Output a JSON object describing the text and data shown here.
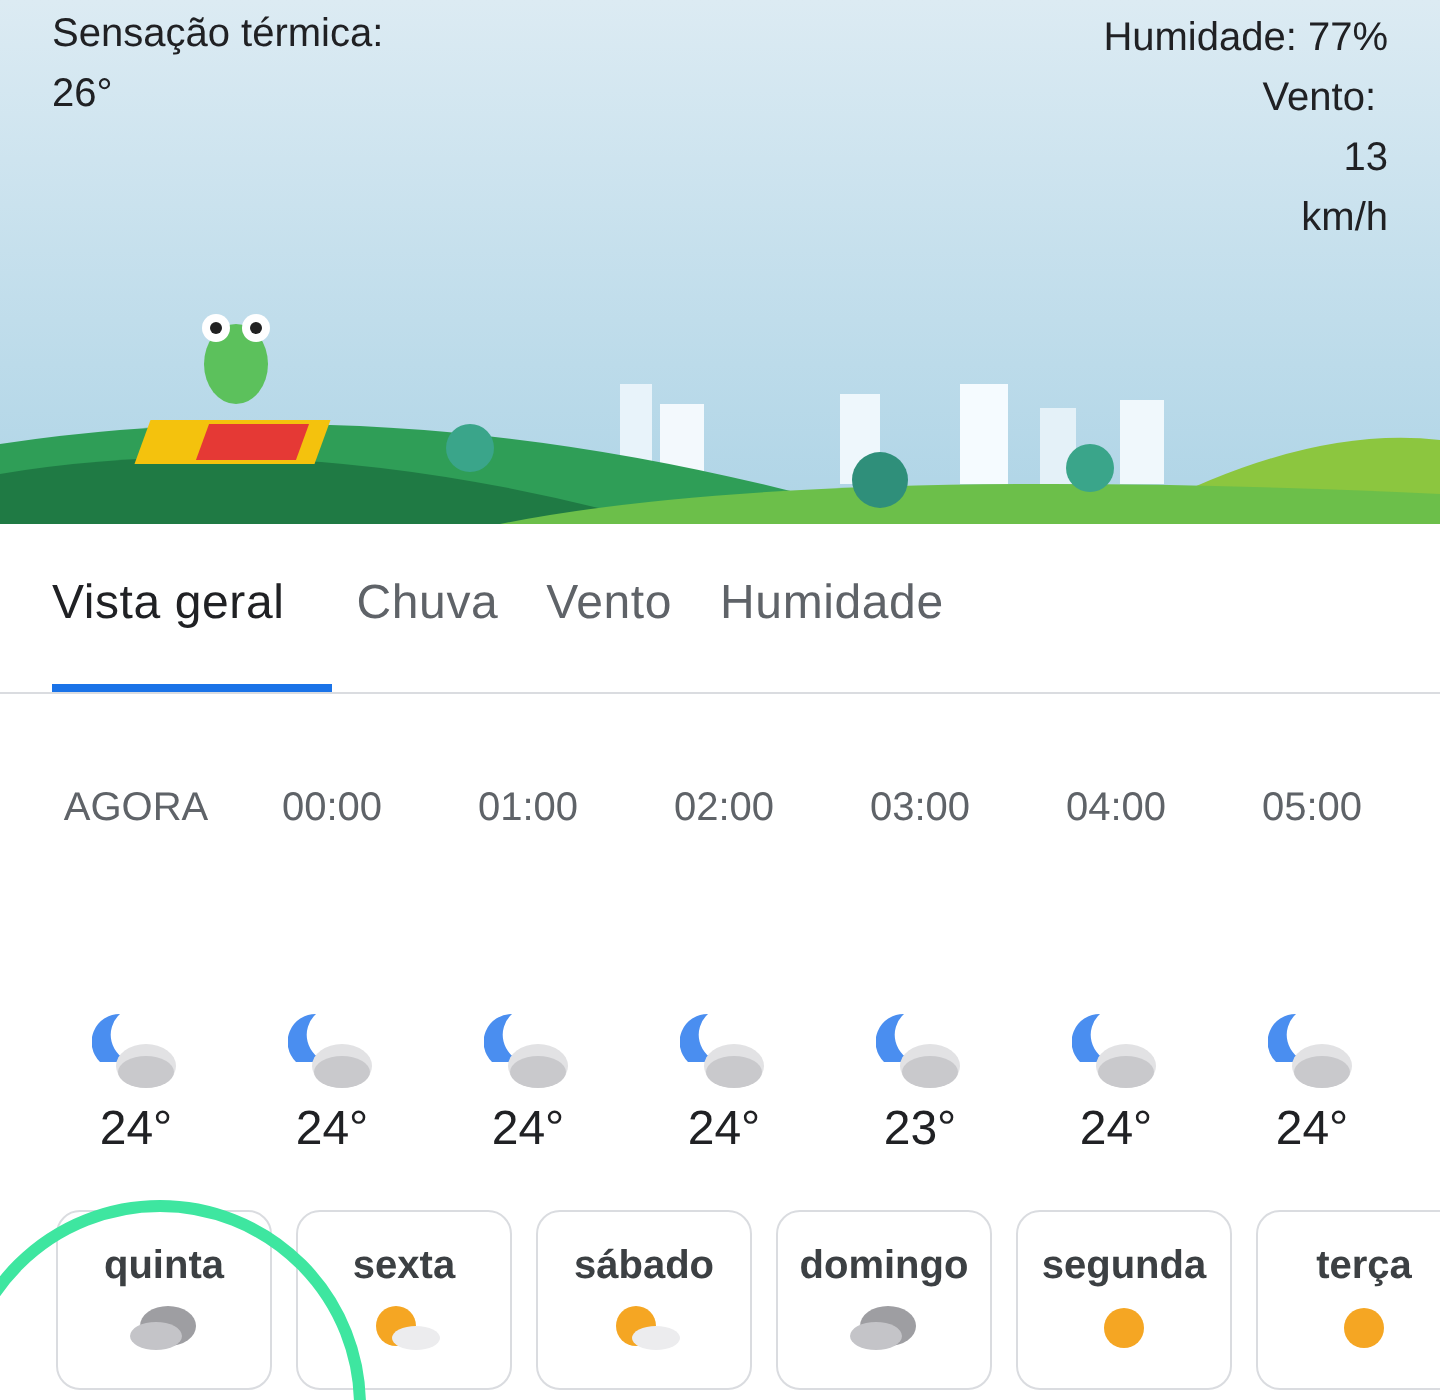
{
  "current": {
    "feels_like_label": "Sensação térmica:",
    "feels_like_value": "26°",
    "humidity": "Humidade: 77%",
    "wind_label": "Vento:",
    "wind_value": "13",
    "wind_unit": "km/h"
  },
  "tabs": [
    {
      "label": "Vista geral",
      "selected": true
    },
    {
      "label": "Chuva",
      "selected": false
    },
    {
      "label": "Vento",
      "selected": false
    },
    {
      "label": "Humidade",
      "selected": false
    }
  ],
  "hourly": [
    {
      "time": "AGORA",
      "kind": "night-cloudy",
      "temp": "24°"
    },
    {
      "time": "00:00",
      "kind": "night-cloudy",
      "temp": "24°"
    },
    {
      "time": "01:00",
      "kind": "night-cloudy",
      "temp": "24°"
    },
    {
      "time": "02:00",
      "kind": "night-cloudy",
      "temp": "24°"
    },
    {
      "time": "03:00",
      "kind": "night-cloudy",
      "temp": "23°"
    },
    {
      "time": "04:00",
      "kind": "night-cloudy",
      "temp": "24°"
    },
    {
      "time": "05:00",
      "kind": "night-cloudy",
      "temp": "24°"
    }
  ],
  "daily": [
    {
      "day": "quinta",
      "kind": "cloudy"
    },
    {
      "day": "sexta",
      "kind": "partly-cloudy"
    },
    {
      "day": "sábado",
      "kind": "partly-cloudy"
    },
    {
      "day": "domingo",
      "kind": "cloudy"
    },
    {
      "day": "segunda",
      "kind": "sunny"
    },
    {
      "day": "terça",
      "kind": "sunny"
    }
  ]
}
